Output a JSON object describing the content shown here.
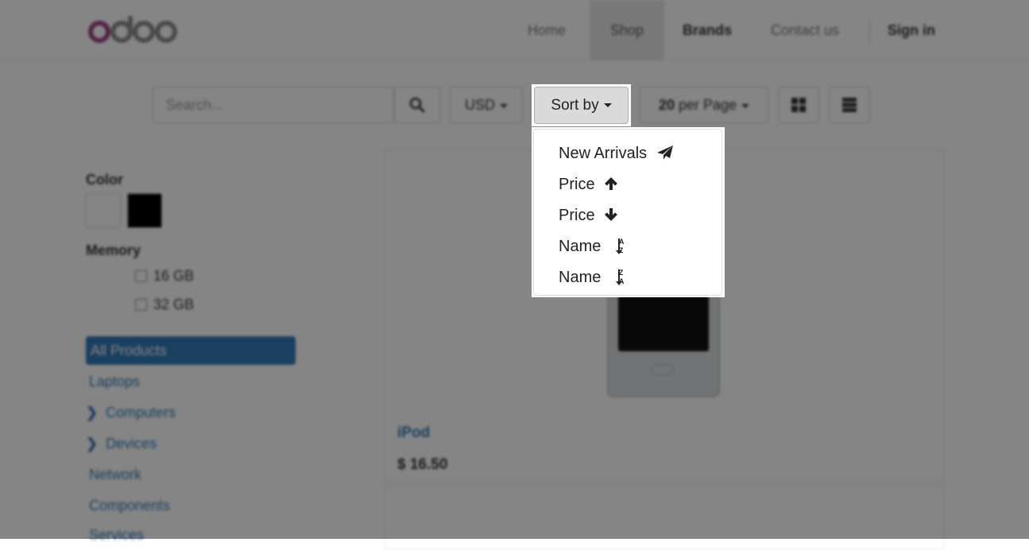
{
  "header": {
    "logo_text": "odoo",
    "nav": [
      {
        "label": "Home"
      },
      {
        "label": "Shop"
      },
      {
        "label": "Brands"
      },
      {
        "label": "Contact us"
      },
      {
        "label": "Sign in"
      }
    ]
  },
  "toolbar": {
    "search_placeholder": "Search...",
    "currency": "USD",
    "sort_label": "Sort by",
    "per_page_count": "20",
    "per_page_suffix": "per Page"
  },
  "sort_menu": {
    "items": [
      {
        "label": "New Arrivals",
        "icon": "paper-plane-icon"
      },
      {
        "label": "Price",
        "icon": "arrow-up-icon"
      },
      {
        "label": "Price",
        "icon": "arrow-down-icon"
      },
      {
        "label": "Name",
        "icon": "sort-alpha-asc-icon",
        "letters": [
          "A",
          "Z"
        ]
      },
      {
        "label": "Name",
        "icon": "sort-alpha-desc-icon",
        "letters": [
          "Z",
          "A"
        ]
      }
    ]
  },
  "sidebar": {
    "color_heading": "Color",
    "colors": [
      "#ffffff",
      "#000000"
    ],
    "memory_heading": "Memory",
    "memory_options": [
      {
        "label": "16 GB"
      },
      {
        "label": "32 GB"
      }
    ],
    "categories": [
      {
        "label": "All Products",
        "active": true
      },
      {
        "label": "Laptops"
      },
      {
        "label": "Computers",
        "expandable": true
      },
      {
        "label": "Devices",
        "expandable": true
      },
      {
        "label": "Network"
      },
      {
        "label": "Components"
      },
      {
        "label": "Services"
      }
    ]
  },
  "product": {
    "name": "iPod",
    "price": "$ 16.50"
  }
}
